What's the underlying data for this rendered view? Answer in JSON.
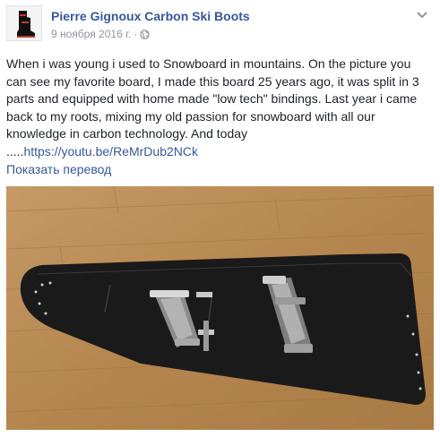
{
  "post": {
    "author": "Pierre Gignoux Carbon Ski Boots",
    "date": "9 ноября 2016 г.",
    "separator": "·",
    "visibility_icon": "globe-icon",
    "menu_icon": "chevron-down-icon",
    "text": "When i was young i used to Snowboard in mountains. On the picture you can see my favorite board, I made this board 25 years ago, it was split in 3 parts and equipped with home made \"low tech\" bindings. Last year i came back to my roots, mixing my old passion for snowboard with all our knowledge in carbon technology. And today .....",
    "link": "https://youtu.be/ReMrDub2NCk",
    "translate": "Показать перевод",
    "photo_description": "black homemade split snowboard with metal bindings on a wooden floor"
  },
  "colors": {
    "link": "#365899",
    "text": "#1d2129",
    "meta": "#90949c",
    "floor": "#b88a55",
    "board": "#1c1c1c"
  }
}
